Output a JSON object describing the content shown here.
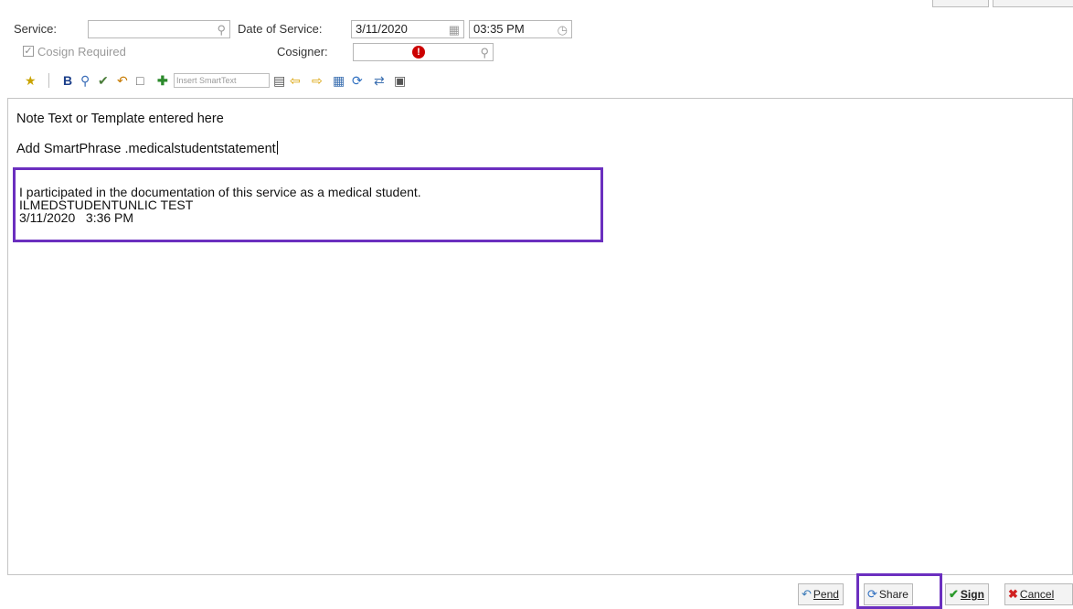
{
  "header": {
    "service_label": "Service:",
    "service_value": "",
    "date_label": "Date of Service:",
    "date_value": "3/11/2020",
    "time_value": "03:35 PM",
    "cosign_label": "Cosign Required",
    "cosign_checked": true,
    "cosigner_label": "Cosigner:",
    "cosigner_value": ""
  },
  "toolbar": {
    "insert_smarttext_placeholder": "Insert SmartText"
  },
  "editor": {
    "line1": "Note Text or Template entered here",
    "line2": "Add SmartPhrase .medicalstudentstatement",
    "statement_line1": "I participated in the documentation of this service as a medical student.",
    "statement_line2": "ILMEDSTUDENTUNLIC TEST",
    "statement_line3": "3/11/2020   3:36 PM"
  },
  "buttons": {
    "pend": "Pend",
    "share": "Share",
    "sign": "Sign",
    "cancel": "Cancel"
  },
  "colors": {
    "highlight": "#6b2fbf",
    "alert": "#cc0000"
  }
}
